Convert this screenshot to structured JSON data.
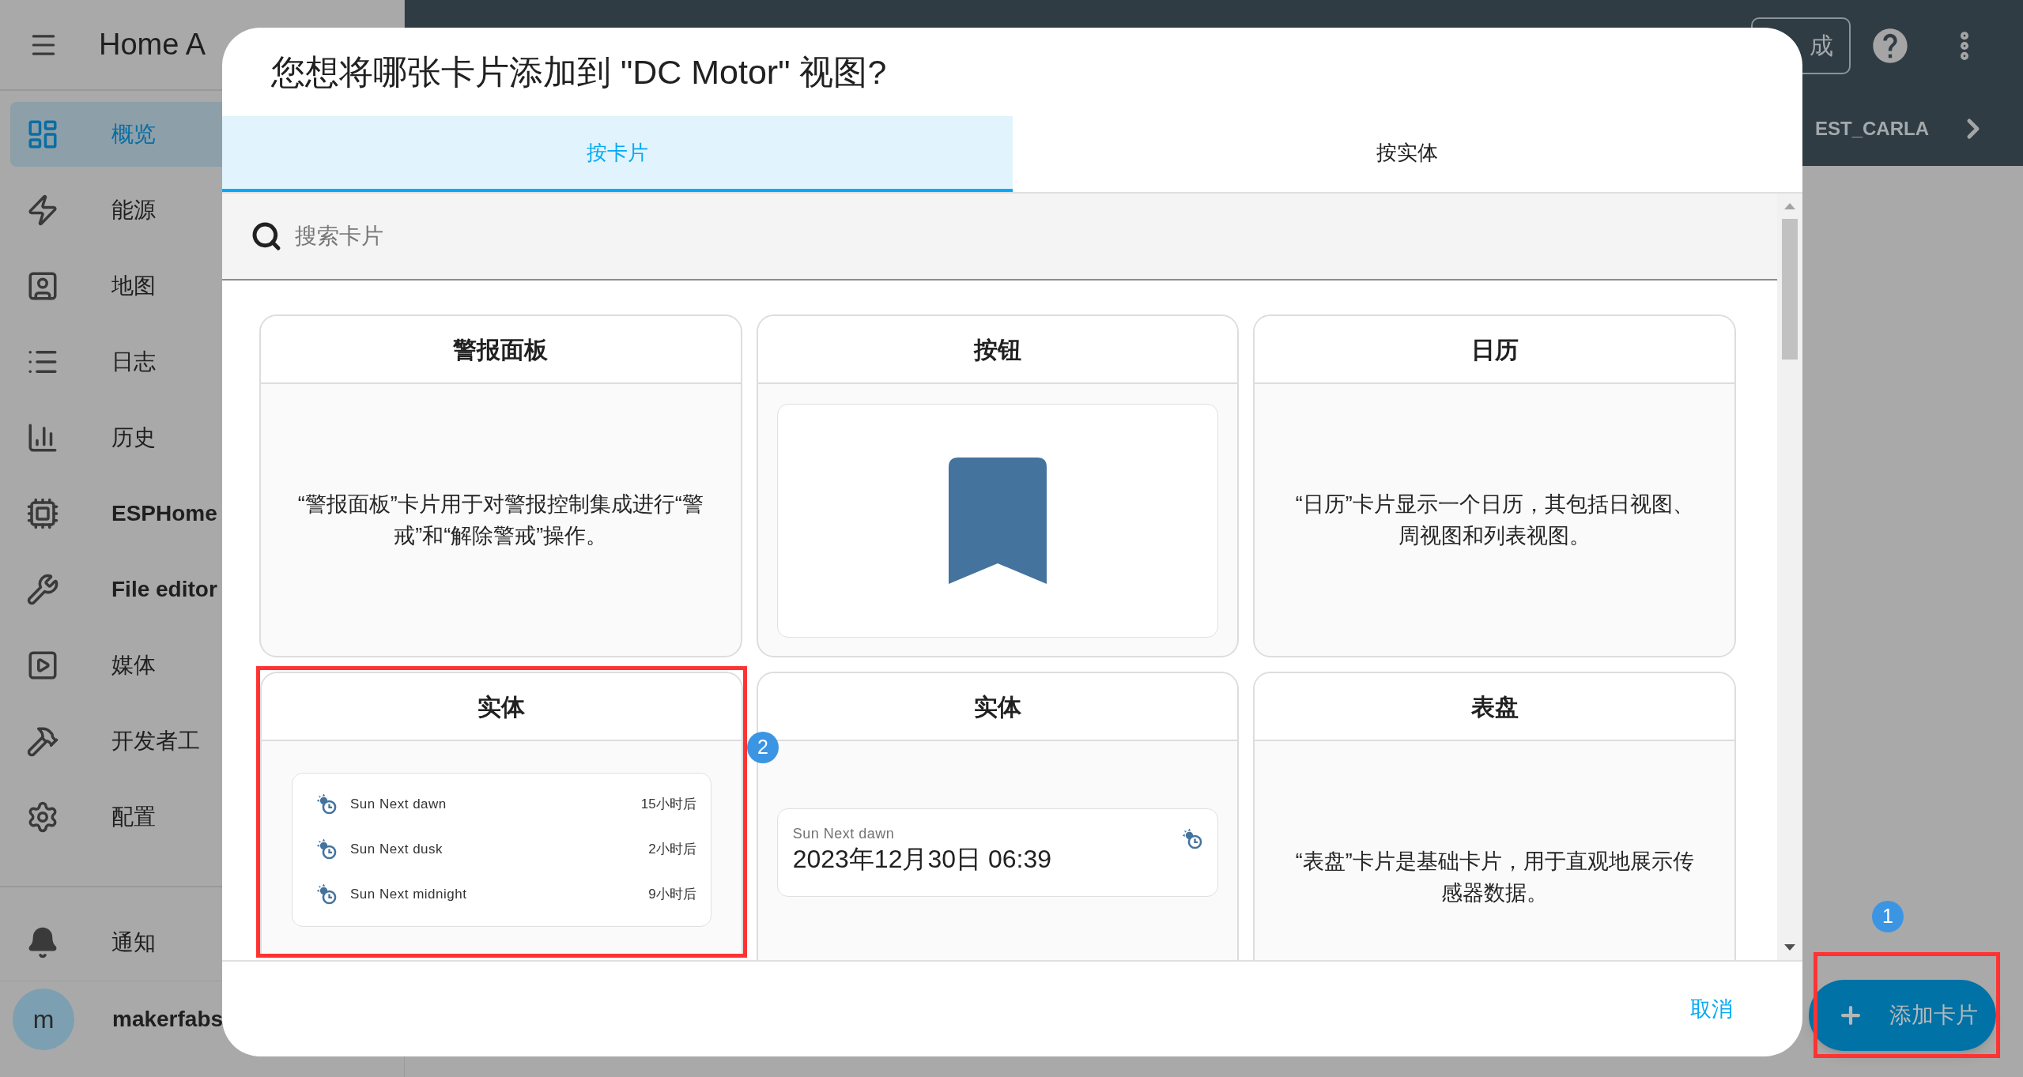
{
  "sidebar": {
    "title": "Home A",
    "items": [
      {
        "label": "概览",
        "selected": true,
        "bold": false
      },
      {
        "label": "能源",
        "selected": false,
        "bold": false
      },
      {
        "label": "地图",
        "selected": false,
        "bold": false
      },
      {
        "label": "日志",
        "selected": false,
        "bold": false
      },
      {
        "label": "历史",
        "selected": false,
        "bold": false
      },
      {
        "label": "ESPHome",
        "selected": false,
        "bold": true
      },
      {
        "label": "File editor",
        "selected": false,
        "bold": true
      },
      {
        "label": "媒体",
        "selected": false,
        "bold": false
      },
      {
        "label": "开发者工",
        "selected": false,
        "bold": false
      },
      {
        "label": "配置",
        "selected": false,
        "bold": false
      }
    ],
    "notifications": {
      "label": "通知"
    },
    "user": {
      "initial": "m",
      "name": "makerfabs"
    }
  },
  "header": {
    "done_button": "成",
    "view_tab": "EST_CARLA"
  },
  "dialog": {
    "title": "您想将哪张卡片添加到 \"DC Motor\" 视图?",
    "tabs": [
      {
        "label": "按卡片",
        "selected": true
      },
      {
        "label": "按实体",
        "selected": false
      }
    ],
    "search": {
      "placeholder": "搜索卡片"
    },
    "cards": [
      {
        "title": "警报面板",
        "kind": "description",
        "highlighted": false,
        "description": "“警报面板”卡片用于对警报控制集成进行“警戒”和“解除警戒”操作。"
      },
      {
        "title": "按钮",
        "kind": "button",
        "highlighted": false
      },
      {
        "title": "日历",
        "kind": "description",
        "highlighted": false,
        "description": "“日历”卡片显示一个日历，其包括日视图、周视图和列表视图。"
      },
      {
        "title": "实体",
        "kind": "entities",
        "highlighted": true,
        "rows": [
          {
            "name": "Sun Next dawn",
            "value": "15小时后"
          },
          {
            "name": "Sun Next dusk",
            "value": "2小时后"
          },
          {
            "name": "Sun Next midnight",
            "value": "9小时后"
          }
        ]
      },
      {
        "title": "实体",
        "kind": "entity",
        "highlighted": false,
        "name": "Sun Next dawn",
        "value": "2023年12月30日 06:39"
      },
      {
        "title": "表盘",
        "kind": "description",
        "highlighted": false,
        "description": "“表盘”卡片是基础卡片，用于直观地展示传感器数据。"
      }
    ],
    "cancel_button": "取消"
  },
  "fab": {
    "label": "添加卡片",
    "highlighted": true
  },
  "badges": [
    {
      "label": "2"
    },
    {
      "label": "1"
    }
  ]
}
